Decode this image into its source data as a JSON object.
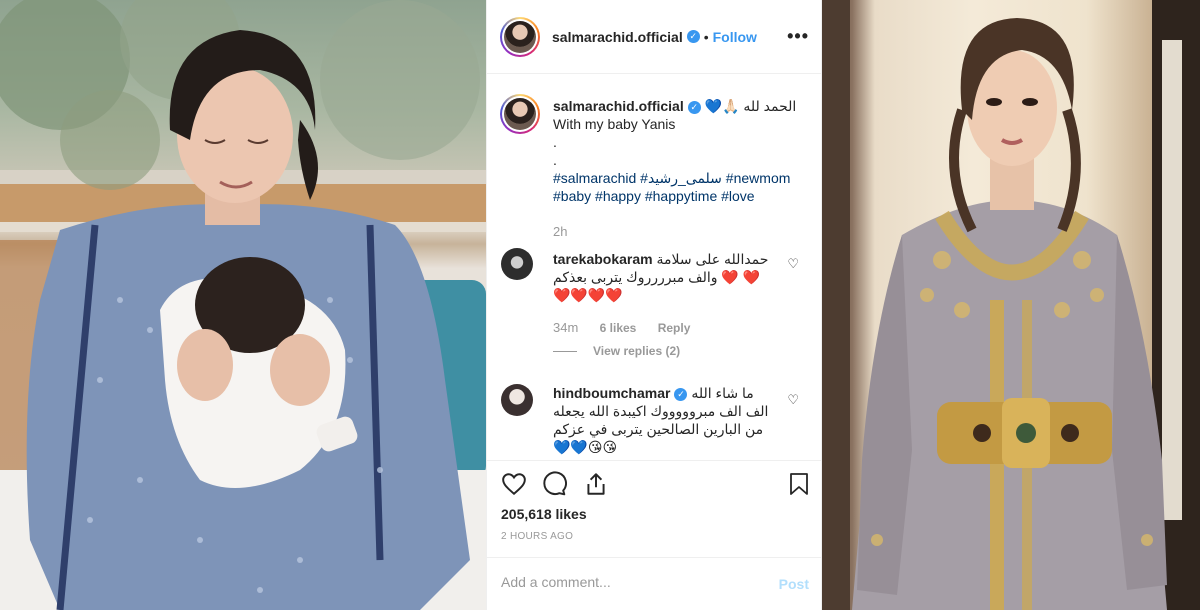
{
  "post": {
    "username": "salmarachid.official",
    "verified_icon": "check-badge-icon",
    "separator": "•",
    "follow_label": "Follow",
    "more_label": "•••"
  },
  "caption": {
    "username": "salmarachid.official",
    "arabic_text": "الحمد لله 🙏🏻💙",
    "line1": "With my baby Yanis",
    "dot1": ".",
    "dot2": ".",
    "hashtags_line1": "#salmarachid #سلمى_رشيد #newmom",
    "hashtags_line2": "#baby #happy #happytime #love",
    "time": "2h"
  },
  "comments": [
    {
      "username": "tarekabokaram",
      "line1": "حمدالله على سلامة",
      "line2": "❤️ ❤️ والف مبرررروك يتربى بعذكم",
      "line3": "❤️❤️❤️❤️",
      "time": "34m",
      "likes": "6 likes",
      "reply_label": "Reply",
      "view_replies": "View replies (2)"
    },
    {
      "username": "hindboumchamar",
      "line1": "ما شاء الله",
      "line2": "الف الف مبروووووك اكيبدة الله يجعله",
      "line3": "من البارين الصالحين يتربى في عزكم",
      "line4": "💙💙😘😘"
    }
  ],
  "actions": {
    "like_icon": "heart-icon",
    "comment_icon": "comment-bubble-icon",
    "share_icon": "share-icon",
    "save_icon": "bookmark-icon"
  },
  "likes_text": "205,618 likes",
  "posted_ago": "2 HOURS AGO",
  "add_comment": {
    "placeholder": "Add a comment...",
    "post_label": "Post"
  },
  "colors": {
    "link_blue": "#3897f0",
    "hashtag": "#003569",
    "muted": "#999999",
    "heart_red": "#ed4956",
    "heart_blue": "#1e73be"
  }
}
